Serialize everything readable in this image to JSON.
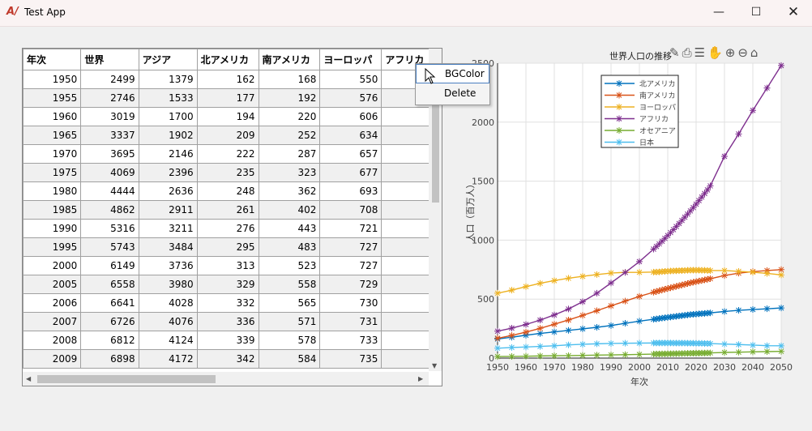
{
  "window": {
    "title": "Test App",
    "icon": "app-logo-icon",
    "controls": [
      "minimize-icon",
      "maximize-icon",
      "close-icon"
    ]
  },
  "table": {
    "columns": [
      "年次",
      "世界",
      "アジア",
      "北アメリカ",
      "南アメリカ",
      "ヨーロッパ",
      "アフリカ"
    ],
    "rows": [
      [
        "1950",
        "2499",
        "1379",
        "162",
        "168",
        "550",
        ""
      ],
      [
        "1955",
        "2746",
        "1533",
        "177",
        "192",
        "576",
        ""
      ],
      [
        "1960",
        "3019",
        "1700",
        "194",
        "220",
        "606",
        ""
      ],
      [
        "1965",
        "3337",
        "1902",
        "209",
        "252",
        "634",
        ""
      ],
      [
        "1970",
        "3695",
        "2146",
        "222",
        "287",
        "657",
        ""
      ],
      [
        "1975",
        "4069",
        "2396",
        "235",
        "323",
        "677",
        ""
      ],
      [
        "1980",
        "4444",
        "2636",
        "248",
        "362",
        "693",
        ""
      ],
      [
        "1985",
        "4862",
        "2911",
        "261",
        "402",
        "708",
        ""
      ],
      [
        "1990",
        "5316",
        "3211",
        "276",
        "443",
        "721",
        ""
      ],
      [
        "1995",
        "5743",
        "3484",
        "295",
        "483",
        "727",
        ""
      ],
      [
        "2000",
        "6149",
        "3736",
        "313",
        "523",
        "727",
        ""
      ],
      [
        "2005",
        "6558",
        "3980",
        "329",
        "558",
        "729",
        ""
      ],
      [
        "2006",
        "6641",
        "4028",
        "332",
        "565",
        "730",
        ""
      ],
      [
        "2007",
        "6726",
        "4076",
        "336",
        "571",
        "731",
        ""
      ],
      [
        "2008",
        "6812",
        "4124",
        "339",
        "578",
        "733",
        ""
      ],
      [
        "2009",
        "6898",
        "4172",
        "342",
        "584",
        "735",
        ""
      ]
    ]
  },
  "context_menu": {
    "items": [
      "BGColor",
      "Delete"
    ]
  },
  "toolbar": {
    "icons": [
      "brush-icon",
      "print-icon",
      "legend-icon",
      "pan-hand-icon",
      "zoom-in-icon",
      "zoom-out-icon",
      "home-icon"
    ]
  },
  "chart_data": {
    "type": "line",
    "title": "世界人口の推移",
    "xlabel": "年次",
    "ylabel": "人口（百万人）",
    "xlim": [
      1950,
      2050
    ],
    "ylim": [
      0,
      2500
    ],
    "xticks": [
      1950,
      1960,
      1970,
      1980,
      1990,
      2000,
      2010,
      2020,
      2030,
      2040,
      2050
    ],
    "yticks": [
      0,
      500,
      1000,
      1500,
      2000,
      2500
    ],
    "grid": true,
    "legend_position": "top-center",
    "marker": "*",
    "x": [
      1950,
      1955,
      1960,
      1965,
      1970,
      1975,
      1980,
      1985,
      1990,
      1995,
      2000,
      2005,
      2006,
      2007,
      2008,
      2009,
      2010,
      2011,
      2012,
      2013,
      2014,
      2015,
      2016,
      2017,
      2018,
      2019,
      2020,
      2021,
      2022,
      2023,
      2024,
      2025,
      2030,
      2035,
      2040,
      2045,
      2050
    ],
    "series": [
      {
        "name": "北アメリカ",
        "color": "#0072BD",
        "values": [
          162,
          177,
          194,
          209,
          222,
          235,
          248,
          261,
          276,
          295,
          313,
          329,
          332,
          336,
          339,
          342,
          345,
          348,
          351,
          354,
          357,
          360,
          363,
          366,
          369,
          371,
          373,
          375,
          377,
          379,
          381,
          383,
          395,
          405,
          412,
          418,
          425
        ]
      },
      {
        "name": "南アメリカ",
        "color": "#D95319",
        "values": [
          168,
          192,
          220,
          252,
          287,
          323,
          362,
          402,
          443,
          483,
          523,
          558,
          565,
          571,
          578,
          584,
          590,
          596,
          602,
          608,
          614,
          620,
          626,
          632,
          638,
          643,
          648,
          653,
          658,
          663,
          668,
          673,
          700,
          720,
          733,
          742,
          750
        ]
      },
      {
        "name": "ヨーロッパ",
        "color": "#EDB120",
        "values": [
          550,
          576,
          606,
          634,
          657,
          677,
          693,
          708,
          721,
          727,
          727,
          729,
          730,
          731,
          733,
          735,
          737,
          738,
          739,
          740,
          741,
          742,
          743,
          744,
          745,
          745,
          745,
          745,
          744,
          744,
          743,
          742,
          742,
          735,
          728,
          718,
          705
        ]
      },
      {
        "name": "アフリカ",
        "color": "#7E2F8E",
        "values": [
          228,
          254,
          285,
          322,
          366,
          416,
          478,
          550,
          637,
          726,
          818,
          924,
          946,
          968,
          991,
          1015,
          1039,
          1064,
          1089,
          1115,
          1141,
          1167,
          1194,
          1221,
          1248,
          1276,
          1305,
          1335,
          1365,
          1395,
          1426,
          1460,
          1710,
          1900,
          2100,
          2290,
          2480
        ]
      },
      {
        "name": "オセアニア",
        "color": "#77AC30",
        "values": [
          13,
          14,
          16,
          18,
          20,
          21,
          23,
          25,
          27,
          29,
          31,
          34,
          35,
          35,
          36,
          36,
          37,
          37,
          38,
          38,
          39,
          39,
          40,
          40,
          41,
          41,
          42,
          42,
          43,
          43,
          44,
          44,
          48,
          50,
          53,
          55,
          57
        ]
      },
      {
        "name": "日本",
        "color": "#4DBEEE",
        "values": [
          84,
          90,
          94,
          99,
          104,
          112,
          117,
          121,
          124,
          126,
          127,
          128,
          128,
          128,
          128,
          128,
          128,
          128,
          127,
          127,
          127,
          127,
          127,
          126,
          126,
          126,
          125,
          125,
          125,
          124,
          124,
          123,
          119,
          115,
          110,
          105,
          104
        ]
      }
    ]
  }
}
